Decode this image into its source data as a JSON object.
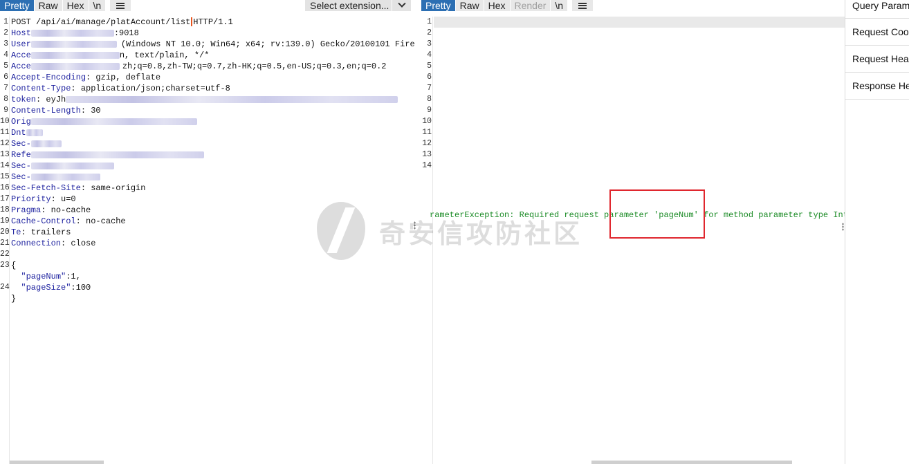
{
  "request": {
    "tabs": [
      "Pretty",
      "Raw",
      "Hex",
      "\\n"
    ],
    "active_tab": "Pretty",
    "select_extension": "Select extension...",
    "line_numbers": [
      "1",
      "2",
      "3",
      "4",
      "5",
      "6",
      "7",
      "8",
      "9",
      "10",
      "11",
      "12",
      "13",
      "14",
      "15",
      "16",
      "17",
      "18",
      "19",
      "20",
      "21",
      "22",
      "23",
      "",
      "24",
      ""
    ],
    "lines": {
      "l1_method": "POST /api/ai/manage/platAccount/list",
      "l1_proto": "HTTP/1.1",
      "l2_key": "Host",
      "l2_val": ":9018",
      "l3_key": "User",
      "l3_val": "(Windows NT 10.0; Win64; x64; rv:139.0) Gecko/20100101 Fire",
      "l4_key": "Acce",
      "l4_val": "n, text/plain, */*",
      "l5_key": "Acce",
      "l5_val": "zh;q=0.8,zh-TW;q=0.7,zh-HK;q=0.5,en-US;q=0.3,en;q=0.2",
      "l6_key": "Accept-Encoding",
      "l6_val": ": gzip, deflate",
      "l7_key": "Content-Type",
      "l7_val": ": application/json;charset=utf-8",
      "l8_key": "token",
      "l8_val": ": eyJh",
      "l9_key": "Content-Length",
      "l9_val": ": 30",
      "l10_key": "Orig",
      "l11_key": "Dnt",
      "l12_key": "Sec-",
      "l13_key": "Refe",
      "l14_key": "Sec-",
      "l15_key": "Sec-",
      "l16_key": "Sec-Fetch-Site",
      "l16_val": ": same-origin",
      "l17_key": "Priority",
      "l17_val": ": u=0",
      "l18_key": "Pragma",
      "l18_val": ": no-cache",
      "l19_key": "Cache-Control",
      "l19_val": ": no-cache",
      "l20_key": "Te",
      "l20_val": ": trailers",
      "l21_key": "Connection",
      "l21_val": ": close",
      "body_open": "{",
      "body_k1": "\"pageNum\"",
      "body_v1": ":1,",
      "body_k2": "\"pageSize\"",
      "body_v2": ":100",
      "body_close": "}"
    }
  },
  "response": {
    "tabs": [
      "Pretty",
      "Raw",
      "Hex",
      "Render",
      "\\n"
    ],
    "active_tab": "Pretty",
    "line_numbers": [
      "1",
      "2",
      "3",
      "4",
      "5",
      "6",
      "7",
      "8",
      "9",
      "10",
      "11",
      "12",
      "13",
      "14"
    ],
    "message": "rameterException: Required request parameter 'pageNum' for method parameter type Inte"
  },
  "inspector": {
    "items": [
      "Query Param",
      "Request Cook",
      "Request Head",
      "Response Hea"
    ]
  },
  "watermark": "奇安信攻防社区",
  "colors": {
    "accent": "#2c6fb3",
    "highlight_box": "#e0272e",
    "response_text": "#198a24"
  }
}
